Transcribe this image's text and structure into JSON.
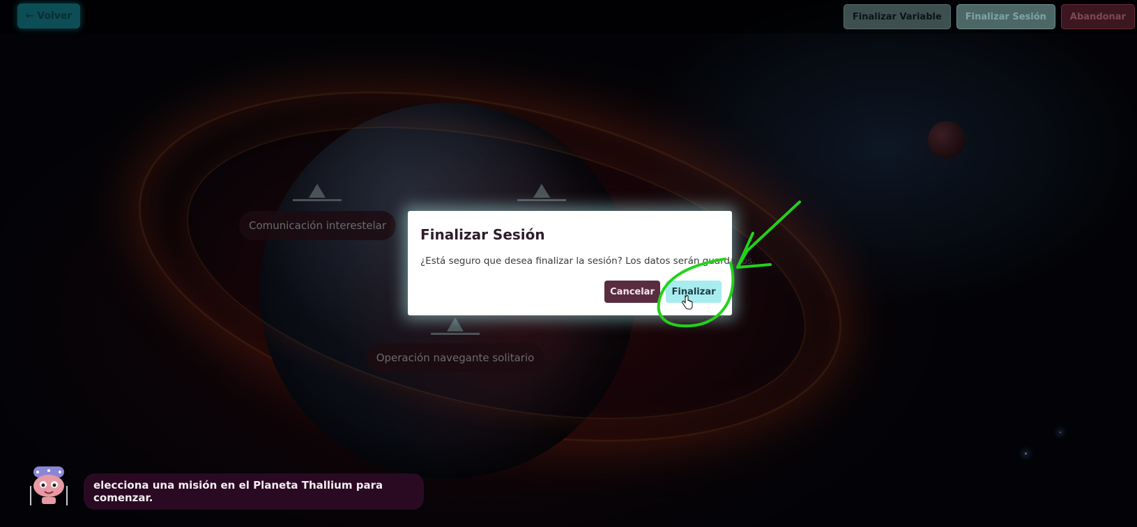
{
  "topbar": {
    "back_label": "← Volver",
    "finish_variable_label": "Finalizar Variable",
    "finish_session_label": "Finalizar Sesión",
    "abandon_label": "Abandonar"
  },
  "missions": [
    {
      "label": "Comunicación interestelar"
    },
    {
      "label": "Operación navegante solitario"
    }
  ],
  "modal": {
    "title": "Finalizar Sesión",
    "message": "¿Está seguro que desea finalizar la sesión? Los datos serán guardados.",
    "cancel_label": "Cancelar",
    "confirm_label": "Finalizar"
  },
  "assistant": {
    "icon": "robot-mascot-icon",
    "message": "elecciona una misión en el Planeta Thallium para comenzar."
  },
  "annotation": {
    "color": "#22d21a",
    "shape": "arrow-and-circle"
  },
  "colors": {
    "cancel_bg": "#5a2c3f",
    "confirm_bg": "#a8ecef",
    "back_bg": "#0d4d55",
    "abandon_bg": "#3c1620"
  }
}
